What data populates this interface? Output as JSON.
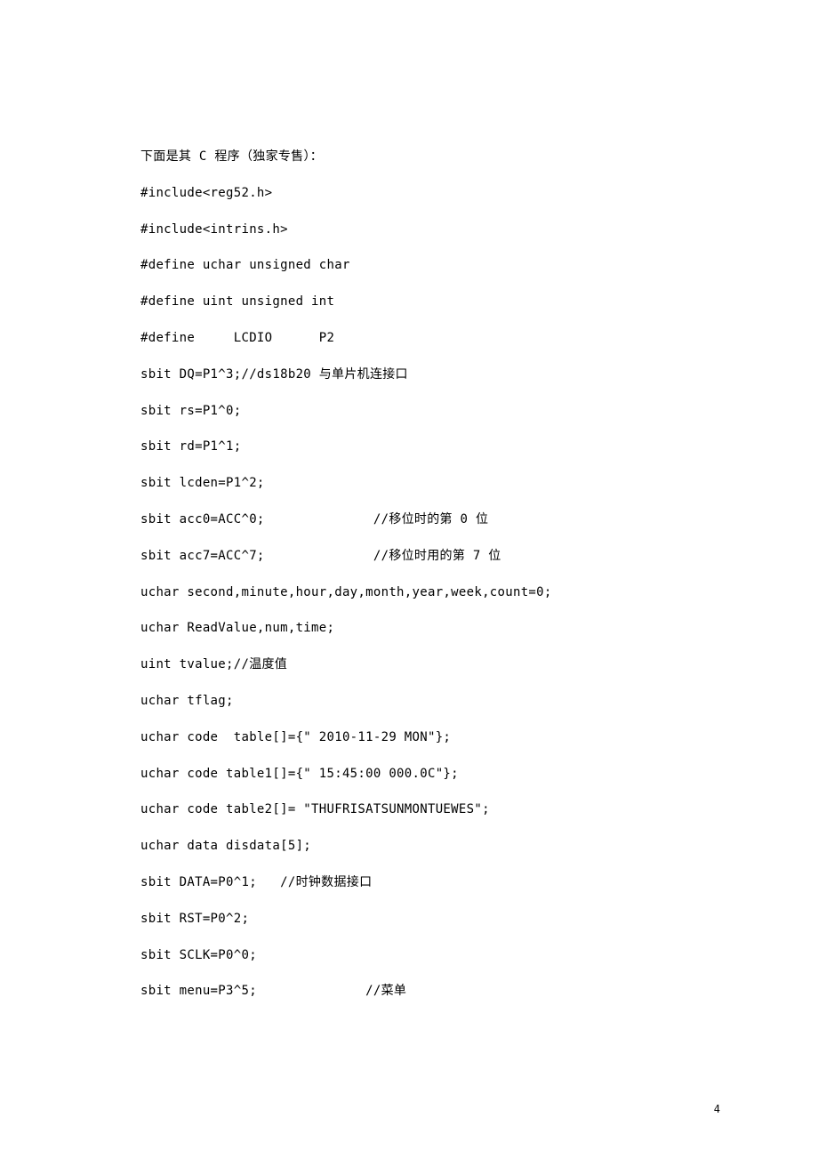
{
  "lines": [
    "下面是其 C 程序（独家专售）：",
    "#include<reg52.h>",
    "#include<intrins.h>",
    "#define uchar unsigned char",
    "#define uint unsigned int",
    "#define     LCDIO      P2",
    "sbit DQ=P1^3;//ds18b20 与单片机连接口",
    "sbit rs=P1^0;",
    "sbit rd=P1^1;",
    "sbit lcden=P1^2;",
    "sbit acc0=ACC^0;              //移位时的第 0 位",
    "sbit acc7=ACC^7;              //移位时用的第 7 位",
    "uchar second,minute,hour,day,month,year,week,count=0;",
    "uchar ReadValue,num,time;",
    "uint tvalue;//温度值",
    "uchar tflag;",
    "uchar code  table[]={\" 2010-11-29 MON\"};",
    "uchar code table1[]={\" 15:45:00 000.0C\"};",
    "uchar code table2[]= \"THUFRISATSUNMONTUEWES\";",
    "uchar data disdata[5];",
    "sbit DATA=P0^1;   //时钟数据接口",
    "sbit RST=P0^2;",
    "sbit SCLK=P0^0;",
    "sbit menu=P3^5;              //菜单"
  ],
  "pageNumber": "4"
}
